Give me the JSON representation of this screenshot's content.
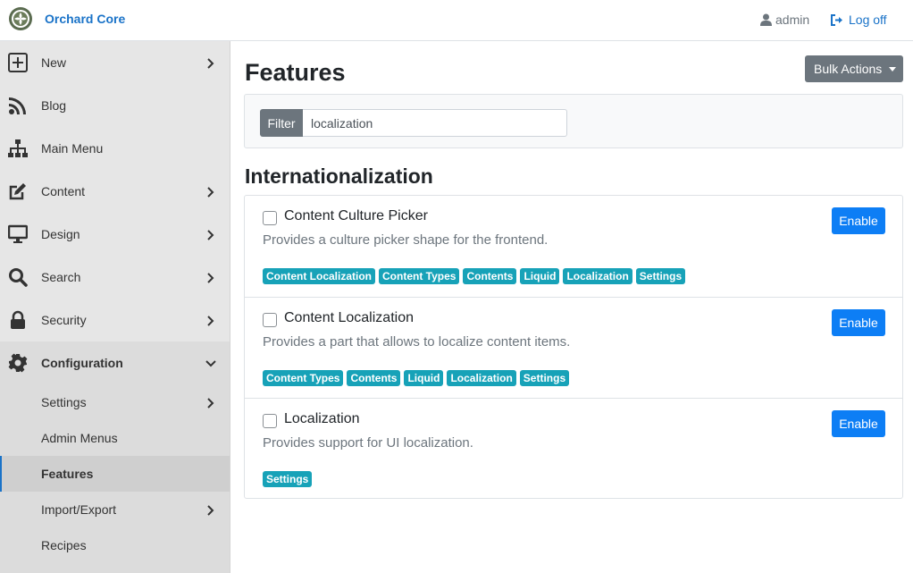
{
  "header": {
    "brand": "Orchard Core",
    "user": "admin",
    "logoff": "Log off"
  },
  "sidebar": {
    "items": [
      {
        "label": "New",
        "icon": "plus-square-icon",
        "chevron": true
      },
      {
        "label": "Blog",
        "icon": "rss-icon",
        "chevron": false
      },
      {
        "label": "Main Menu",
        "icon": "sitemap-icon",
        "chevron": false
      },
      {
        "label": "Content",
        "icon": "edit-icon",
        "chevron": true
      },
      {
        "label": "Design",
        "icon": "desktop-icon",
        "chevron": true
      },
      {
        "label": "Search",
        "icon": "search-icon",
        "chevron": true
      },
      {
        "label": "Security",
        "icon": "lock-icon",
        "chevron": true
      },
      {
        "label": "Configuration",
        "icon": "gear-icon",
        "chevron": "down"
      }
    ],
    "subitems": [
      {
        "label": "Settings",
        "chevron": true
      },
      {
        "label": "Admin Menus",
        "chevron": false
      },
      {
        "label": "Features",
        "chevron": false,
        "active": true
      },
      {
        "label": "Import/Export",
        "chevron": true
      },
      {
        "label": "Recipes",
        "chevron": false
      }
    ]
  },
  "main": {
    "title": "Features",
    "bulk_actions": "Bulk Actions",
    "filter_label": "Filter",
    "filter_value": "localization",
    "section_title": "Internationalization",
    "features": [
      {
        "name": "Content Culture Picker",
        "description": "Provides a culture picker shape for the frontend.",
        "button": "Enable",
        "tags": [
          "Content Localization",
          "Content Types",
          "Contents",
          "Liquid",
          "Localization",
          "Settings"
        ]
      },
      {
        "name": "Content Localization",
        "description": "Provides a part that allows to localize content items.",
        "button": "Enable",
        "tags": [
          "Content Types",
          "Contents",
          "Liquid",
          "Localization",
          "Settings"
        ]
      },
      {
        "name": "Localization",
        "description": "Provides support for UI localization.",
        "button": "Enable",
        "tags": [
          "Settings"
        ]
      }
    ]
  },
  "colors": {
    "accent": "#1a73c8",
    "enable_button": "#0d7ef5",
    "tag": "#17a2b8",
    "secondary": "#6c757d"
  }
}
